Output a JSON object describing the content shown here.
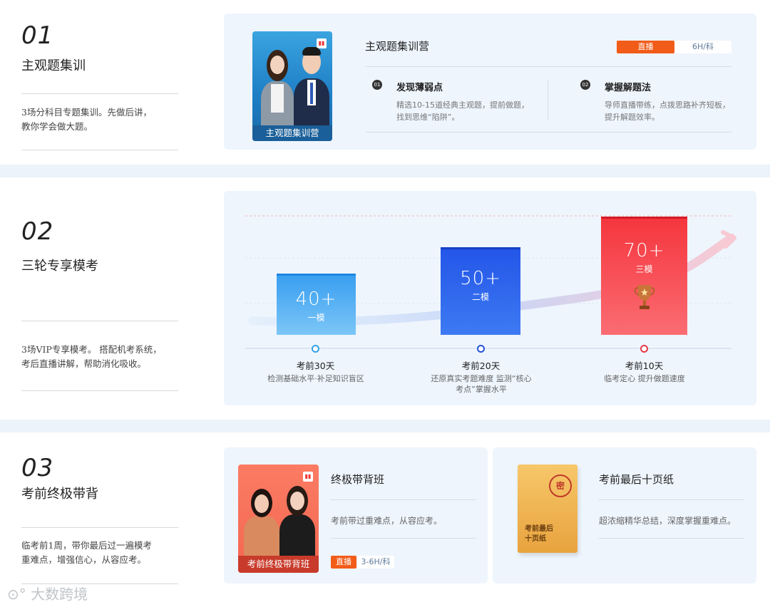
{
  "section1": {
    "num": "01",
    "title": "主观题集训",
    "desc_line1": "3场分科目专题集训。先做后讲，",
    "desc_line2": "教你学会做大题。",
    "cover_caption": "主观题集训营",
    "product_title": "主观题集训营",
    "tag_live": "直播",
    "tag_duration": "6H/科",
    "features": [
      {
        "badge": "01",
        "title": "发现薄弱点",
        "desc_line1": "精选10-15道经典主观题，提前做题，",
        "desc_line2": "找到思维“陷阱”。"
      },
      {
        "badge": "02",
        "title": "掌握解题法",
        "desc_line1": "导师直播带练，点拨思路补齐短板，",
        "desc_line2": "提升解题效率。"
      }
    ]
  },
  "section2": {
    "num": "02",
    "title": "三轮专享模考",
    "desc_line1": "3场VIP专享模考。 搭配机考系统，",
    "desc_line2": "考后直播讲解，帮助消化吸收。",
    "mocks": [
      {
        "big": "40+",
        "sub": "一模",
        "label": "考前30天",
        "desc_line1": "检测基础水平·补足知识盲区",
        "desc_line2": "",
        "color": "#3a9ff0"
      },
      {
        "big": "50+",
        "sub": "二模",
        "label": "考前20天",
        "desc_line1": "还原真实考题难度 监测“核心",
        "desc_line2": "考点”掌握水平",
        "color": "#2456e8"
      },
      {
        "big": "70+",
        "sub": "三模",
        "label": "考前10天",
        "desc_line1": "临考定心 提升做题速度",
        "desc_line2": "",
        "color": "#f5363e"
      }
    ]
  },
  "section3": {
    "num": "03",
    "title": "考前终极带背",
    "desc_line1": "临考前1周，带你最后过一遍模考",
    "desc_line2": "重难点，增强信心，从容应考。",
    "card1": {
      "cover_caption": "考前终极带背班",
      "title": "终极带背班",
      "desc": "考前带过重难点，从容应考。",
      "tag_live": "直播",
      "tag_duration": "3-6H/科"
    },
    "card2": {
      "seal": "密",
      "envelope_line1": "考前最后",
      "envelope_line2": "十页纸",
      "title": "考前最后十页纸",
      "desc": "超浓缩精华总结，深度掌握重难点。"
    }
  },
  "watermark": "大数跨境",
  "colors": {
    "live_tag": "#f25c19",
    "panel_bg": "#eef5fd",
    "page_bg": "#edf3fa"
  }
}
